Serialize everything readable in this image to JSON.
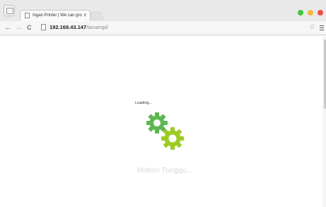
{
  "browser": {
    "tab": {
      "title": "Ingan Printer | We can grow",
      "close": "x"
    },
    "nav": {
      "back": "←",
      "forward": "→",
      "reload": "C"
    },
    "address": {
      "host": "192.168.43.147",
      "path": "/tanampl/"
    },
    "bookmark": "☆",
    "colors": {
      "close": "#f24e4e",
      "minimize": "#f8b83a",
      "maximize": "#40c93f"
    }
  },
  "page": {
    "loading_label": "Loading...",
    "wait_text": "Mohon Tunggu...",
    "colors": {
      "gear_dark": "#5cb84f",
      "gear_light": "#9ccc24"
    }
  }
}
